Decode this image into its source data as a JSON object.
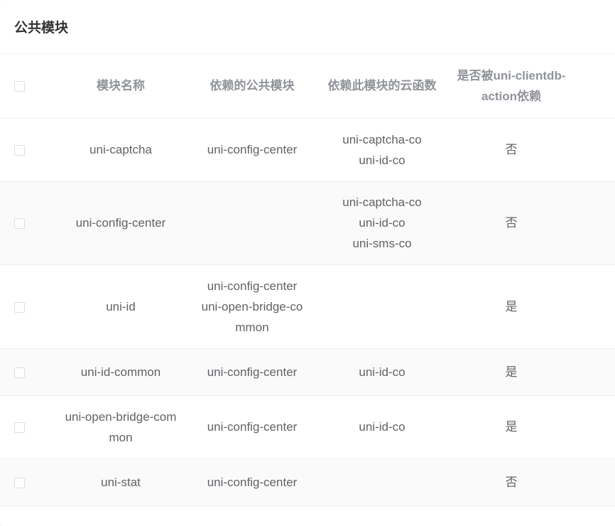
{
  "panel": {
    "title": "公共模块"
  },
  "table": {
    "headers": {
      "name": "模块名称",
      "deps": "依赖的公共模块",
      "dependents": "依赖此模块的云函数",
      "clientdb_dep_line1": "是否被uni-clientdb-",
      "clientdb_dep_line2": "action依赖"
    },
    "rows": [
      {
        "name": "uni-captcha",
        "deps": [
          "uni-config-center"
        ],
        "dependents": [
          "uni-captcha-co",
          "uni-id-co"
        ],
        "clientdb": "否"
      },
      {
        "name": "uni-config-center",
        "deps": [],
        "dependents": [
          "uni-captcha-co",
          "uni-id-co",
          "uni-sms-co"
        ],
        "clientdb": "否"
      },
      {
        "name": "uni-id",
        "deps": [
          "uni-config-center",
          "uni-open-bridge-co",
          "mmon"
        ],
        "dependents": [],
        "clientdb": "是"
      },
      {
        "name": "uni-id-common",
        "deps": [
          "uni-config-center"
        ],
        "dependents": [
          "uni-id-co"
        ],
        "clientdb": "是"
      },
      {
        "name_lines": [
          "uni-open-bridge-com",
          "mon"
        ],
        "deps": [
          "uni-config-center"
        ],
        "dependents": [
          "uni-id-co"
        ],
        "clientdb": "是"
      },
      {
        "name": "uni-stat",
        "deps": [
          "uni-config-center"
        ],
        "dependents": [],
        "clientdb": "否"
      }
    ]
  }
}
